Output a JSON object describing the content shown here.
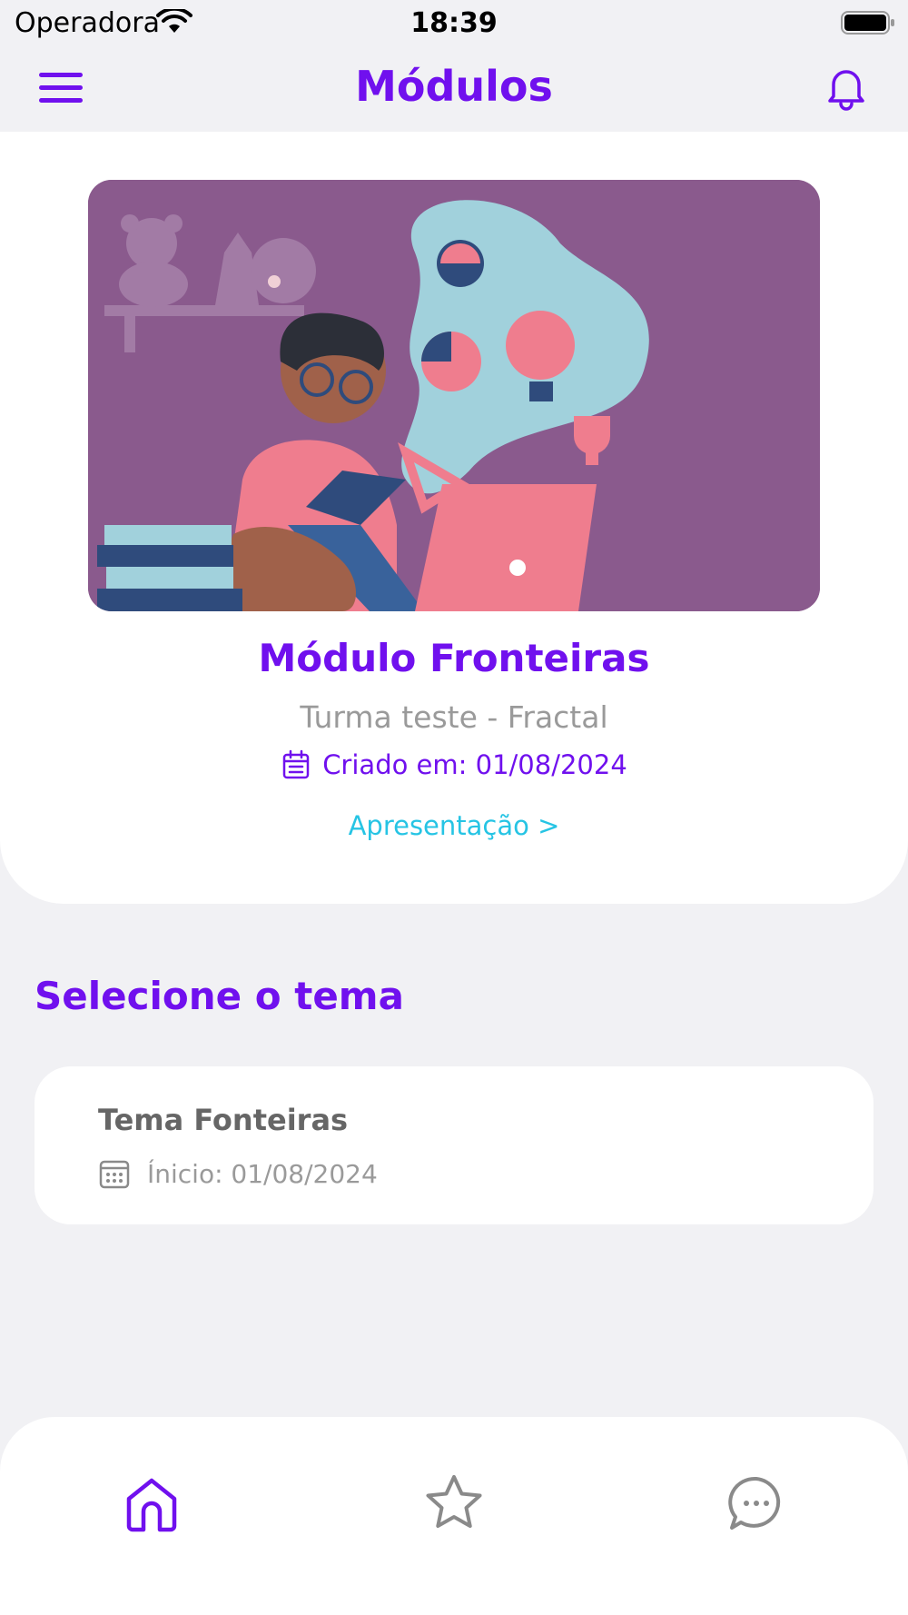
{
  "status_bar": {
    "carrier": "Operadora",
    "time": "18:39"
  },
  "header": {
    "title": "Módulos",
    "menu_icon": "hamburger-menu-icon",
    "notification_icon": "bell-icon"
  },
  "module": {
    "title": "Módulo Fronteiras",
    "class_name": "Turma teste - Fractal",
    "created_label": "Criado em: 01/08/2024",
    "presentation_link": "Apresentação >"
  },
  "themes_section": {
    "title": "Selecione o tema",
    "items": [
      {
        "title": "Tema Fonteiras",
        "start_label": "Ínicio: 01/08/2024"
      }
    ]
  },
  "bottom_nav": {
    "items": [
      {
        "icon": "home-icon",
        "active": true
      },
      {
        "icon": "star-icon",
        "active": false
      },
      {
        "icon": "chat-bubble-icon",
        "active": false
      }
    ]
  },
  "colors": {
    "accent": "#7010ee",
    "link": "#26c4e4",
    "muted_text": "#9a9a9a",
    "background": "#f1f1f4",
    "hero_background": "#8a5a8d"
  }
}
